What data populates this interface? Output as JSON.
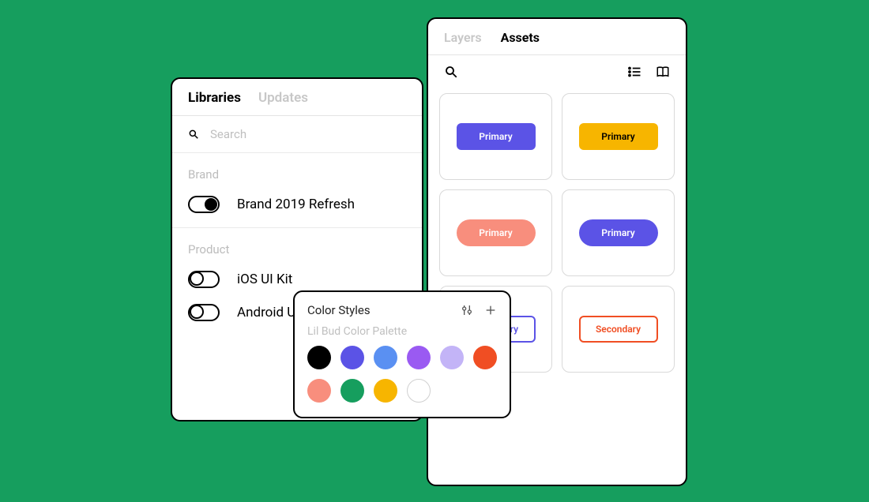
{
  "libraries": {
    "tabs": {
      "libraries": "Libraries",
      "updates": "Updates"
    },
    "search_placeholder": "Search",
    "section_brand": "Brand",
    "brand_item": {
      "name": "Brand 2019 Refresh",
      "on": true
    },
    "section_product": "Product",
    "product_items": [
      {
        "name": "iOS UI Kit",
        "on": false
      },
      {
        "name": "Android UI",
        "on": false
      }
    ]
  },
  "assets": {
    "tabs": {
      "layers": "Layers",
      "assets": "Assets"
    },
    "cards": [
      {
        "type": "square",
        "label": "Primary",
        "bg": "#5b53e6",
        "fg": "#ffffff"
      },
      {
        "type": "square",
        "label": "Primary",
        "bg": "#f7b500",
        "fg": "#000000"
      },
      {
        "type": "pill",
        "label": "Primary",
        "bg": "#f88e7d",
        "fg": "#ffffff"
      },
      {
        "type": "pill",
        "label": "Primary",
        "bg": "#5b53e6",
        "fg": "#ffffff"
      },
      {
        "type": "outline",
        "label": "Secondary",
        "border": "#5b53e6",
        "fg": "#5b53e6"
      },
      {
        "type": "outline",
        "label": "Secondary",
        "border": "#f04e23",
        "fg": "#f04e23"
      }
    ]
  },
  "color_styles": {
    "title": "Color Styles",
    "subtitle": "Lil Bud Color Palette",
    "swatches": [
      "#000000",
      "#5b53e6",
      "#5a90f2",
      "#9a5af2",
      "#c3b4f7",
      "#f04e23",
      "#f88e7d",
      "#169e5e",
      "#f7b500",
      null
    ]
  }
}
